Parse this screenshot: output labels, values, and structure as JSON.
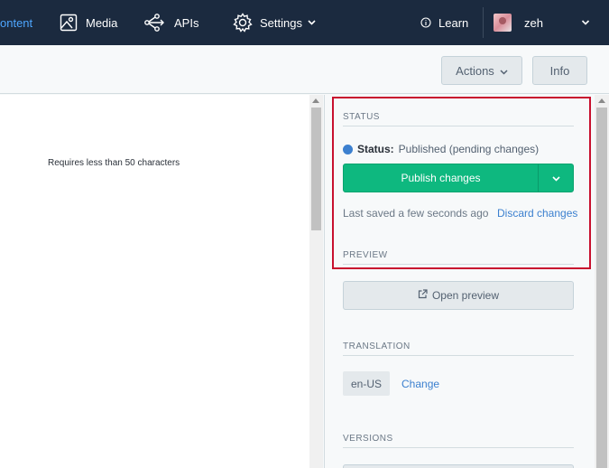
{
  "nav": {
    "content_label": "ontent",
    "media_label": "Media",
    "apis_label": "APIs",
    "settings_label": "Settings",
    "learn_label": "Learn",
    "user_label": "zeh"
  },
  "toolbar": {
    "actions_label": "Actions",
    "info_label": "Info"
  },
  "editor": {
    "hint": "Requires less than 50 characters"
  },
  "sidebar": {
    "status": {
      "title": "STATUS",
      "key": "Status:",
      "value": "Published (pending changes)",
      "publish_label": "Publish changes",
      "saved_text": "Last saved a few seconds ago",
      "discard_label": "Discard changes"
    },
    "preview": {
      "title": "PREVIEW",
      "button_label": "Open preview"
    },
    "translation": {
      "title": "TRANSLATION",
      "locale": "en-US",
      "change_label": "Change"
    },
    "versions": {
      "title": "VERSIONS"
    }
  },
  "colors": {
    "nav_bg": "#1b2a3f",
    "accent_link": "#3c80cf",
    "publish_green": "#0eb87f",
    "highlight_red": "#c8102e"
  },
  "icons": {
    "media": "image-icon",
    "apis": "share-nodes-icon",
    "settings": "gear-icon",
    "learn": "info-icon",
    "preview": "external-link-icon"
  }
}
